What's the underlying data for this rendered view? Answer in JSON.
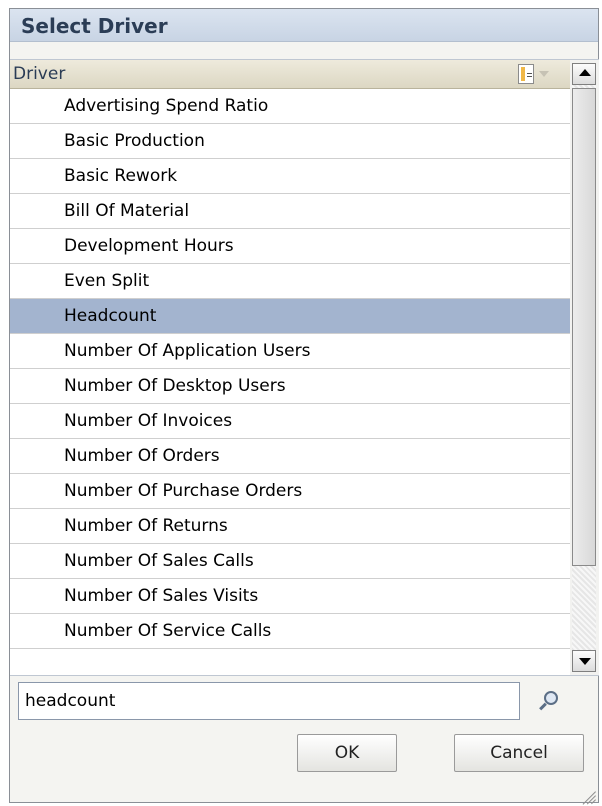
{
  "dialog": {
    "title": "Select Driver"
  },
  "table": {
    "column_header": "Driver",
    "column_menu_icon": "column-options-icon",
    "selected_index": 6,
    "rows": [
      "Advertising Spend Ratio",
      "Basic Production",
      "Basic Rework",
      "Bill Of Material",
      "Development Hours",
      "Even Split",
      "Headcount",
      "Number Of Application Users",
      "Number Of Desktop Users",
      "Number Of Invoices",
      "Number Of Orders",
      "Number Of Purchase Orders",
      "Number Of Returns",
      "Number Of Sales Calls",
      "Number Of Sales Visits",
      "Number Of Service Calls"
    ]
  },
  "search": {
    "value": "headcount",
    "icon": "search-icon"
  },
  "buttons": {
    "ok_label": "OK",
    "cancel_label": "Cancel"
  },
  "colors": {
    "selected_row": "#a3b4cf",
    "title_text": "#2b3d56",
    "header_bg": "#dcd7c3"
  }
}
